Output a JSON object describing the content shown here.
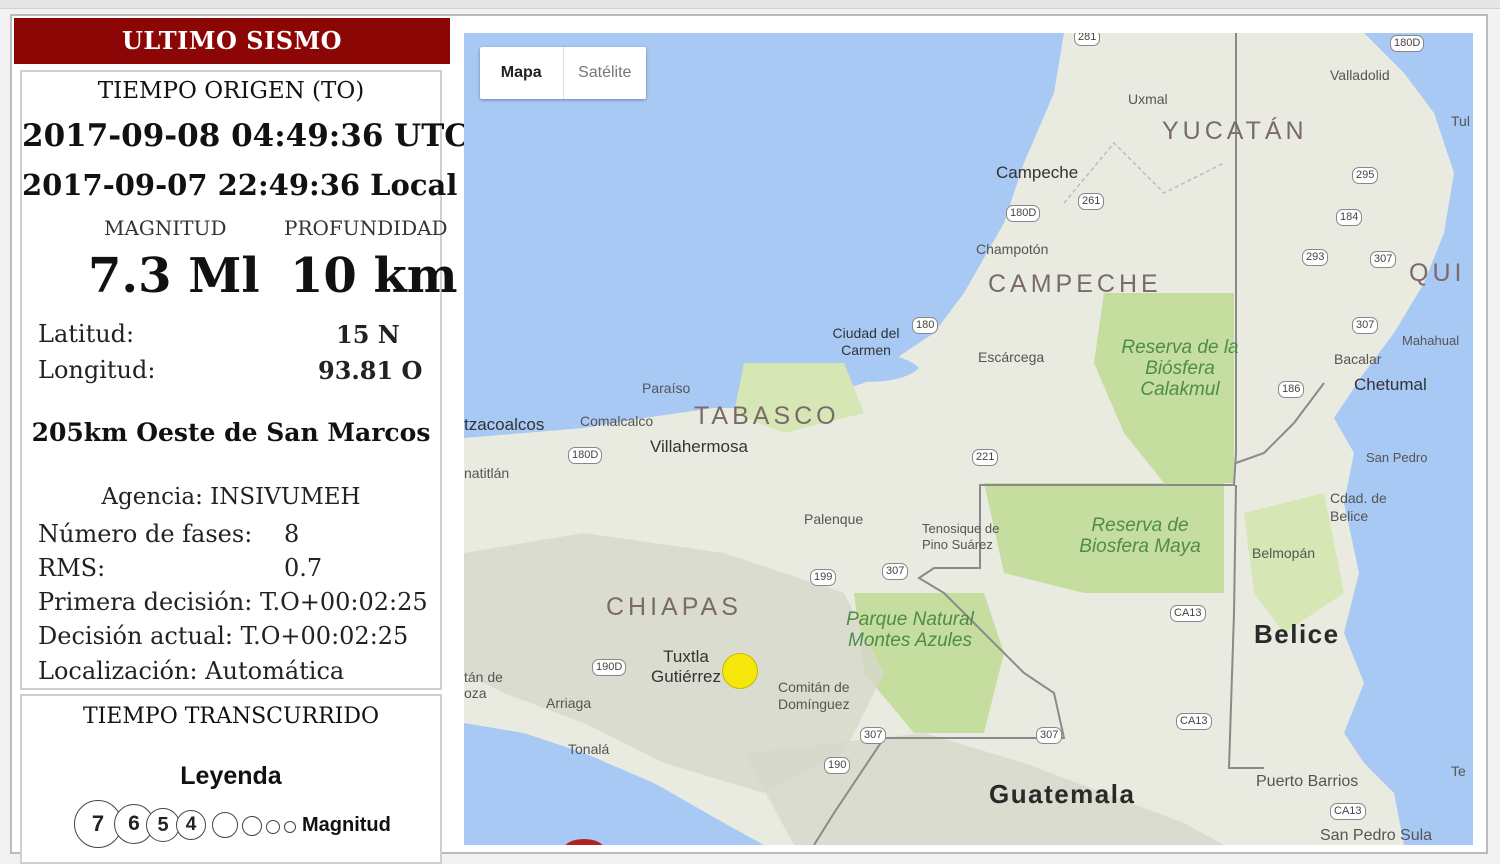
{
  "panel": {
    "header": "ULTIMO SISMO",
    "origin_label": "TIEMPO ORIGEN (TO)",
    "utc_time": "2017-09-08 04:49:36 UTC",
    "local_time": "2017-09-07 22:49:36 Local",
    "magnitude_label": "MAGNITUD",
    "depth_label": "PROFUNDIDAD",
    "magnitude_value": "7.3 Ml",
    "depth_value": "10 km",
    "latitude_label": "Latitud:",
    "latitude_value": "15 N",
    "longitude_label": "Longitud:",
    "longitude_value": "93.81 O",
    "location_text": "205km Oeste de San Marcos",
    "agency": "Agencia: INSIVUMEH",
    "phases_label": "Número de fases:",
    "phases_value": "8",
    "rms_label": "RMS:",
    "rms_value": "0.7",
    "first_decision": "Primera decisión: T.O+00:02:25",
    "current_decision": "Decisión actual: T.O+00:02:25",
    "localization": "Localización: Automática",
    "elapsed_label": "TIEMPO TRANSCURRIDO",
    "legend_title": "Leyenda",
    "legend_sizes": [
      "7",
      "6",
      "5",
      "4"
    ],
    "legend_magnitude_label": "Magnitud"
  },
  "map": {
    "tabs": {
      "map": "Mapa",
      "satellite": "Satélite"
    },
    "states": [
      "YUCATÁN",
      "CAMPECHE",
      "TABASCO",
      "CHIAPAS",
      "QUI"
    ],
    "countries": [
      "Belice",
      "Guatemala"
    ],
    "cities": [
      "Valladolid",
      "Uxmal",
      "Campeche",
      "Champotón",
      "Ciudad del Carmen",
      "Escárcega",
      "Paraíso",
      "Comalcalco",
      "Villahermosa",
      "tzacoalcos",
      "natitlán",
      "Palenque",
      "Tenosique de Pino Suárez",
      "Tuxtla Gutiérrez",
      "Comitán de Domínguez",
      "Arriaga",
      "Tonalá",
      "Chetumal",
      "Bacalar",
      "Mahahual",
      "San Pedro",
      "Cdad. de Belice",
      "Belmopán",
      "Puerto Barrios",
      "San Pedro Sula",
      "tán de oza",
      "Tul",
      "Te"
    ],
    "reserves": [
      "Reserva de la Biósfera Calakmul",
      "Reserva de Biosfera Maya",
      "Parque Natural Montes Azules"
    ],
    "shields": [
      "281",
      "180D",
      "295",
      "261",
      "180D",
      "184",
      "293",
      "307",
      "180",
      "307",
      "186",
      "180D",
      "221",
      "199",
      "307",
      "190D",
      "CA13",
      "CA13",
      "307",
      "307",
      "190",
      "CA13"
    ],
    "epicenter_color": "#f6e60b",
    "water_color": "#a9c9f5",
    "land_color": "#e9ebe0"
  }
}
